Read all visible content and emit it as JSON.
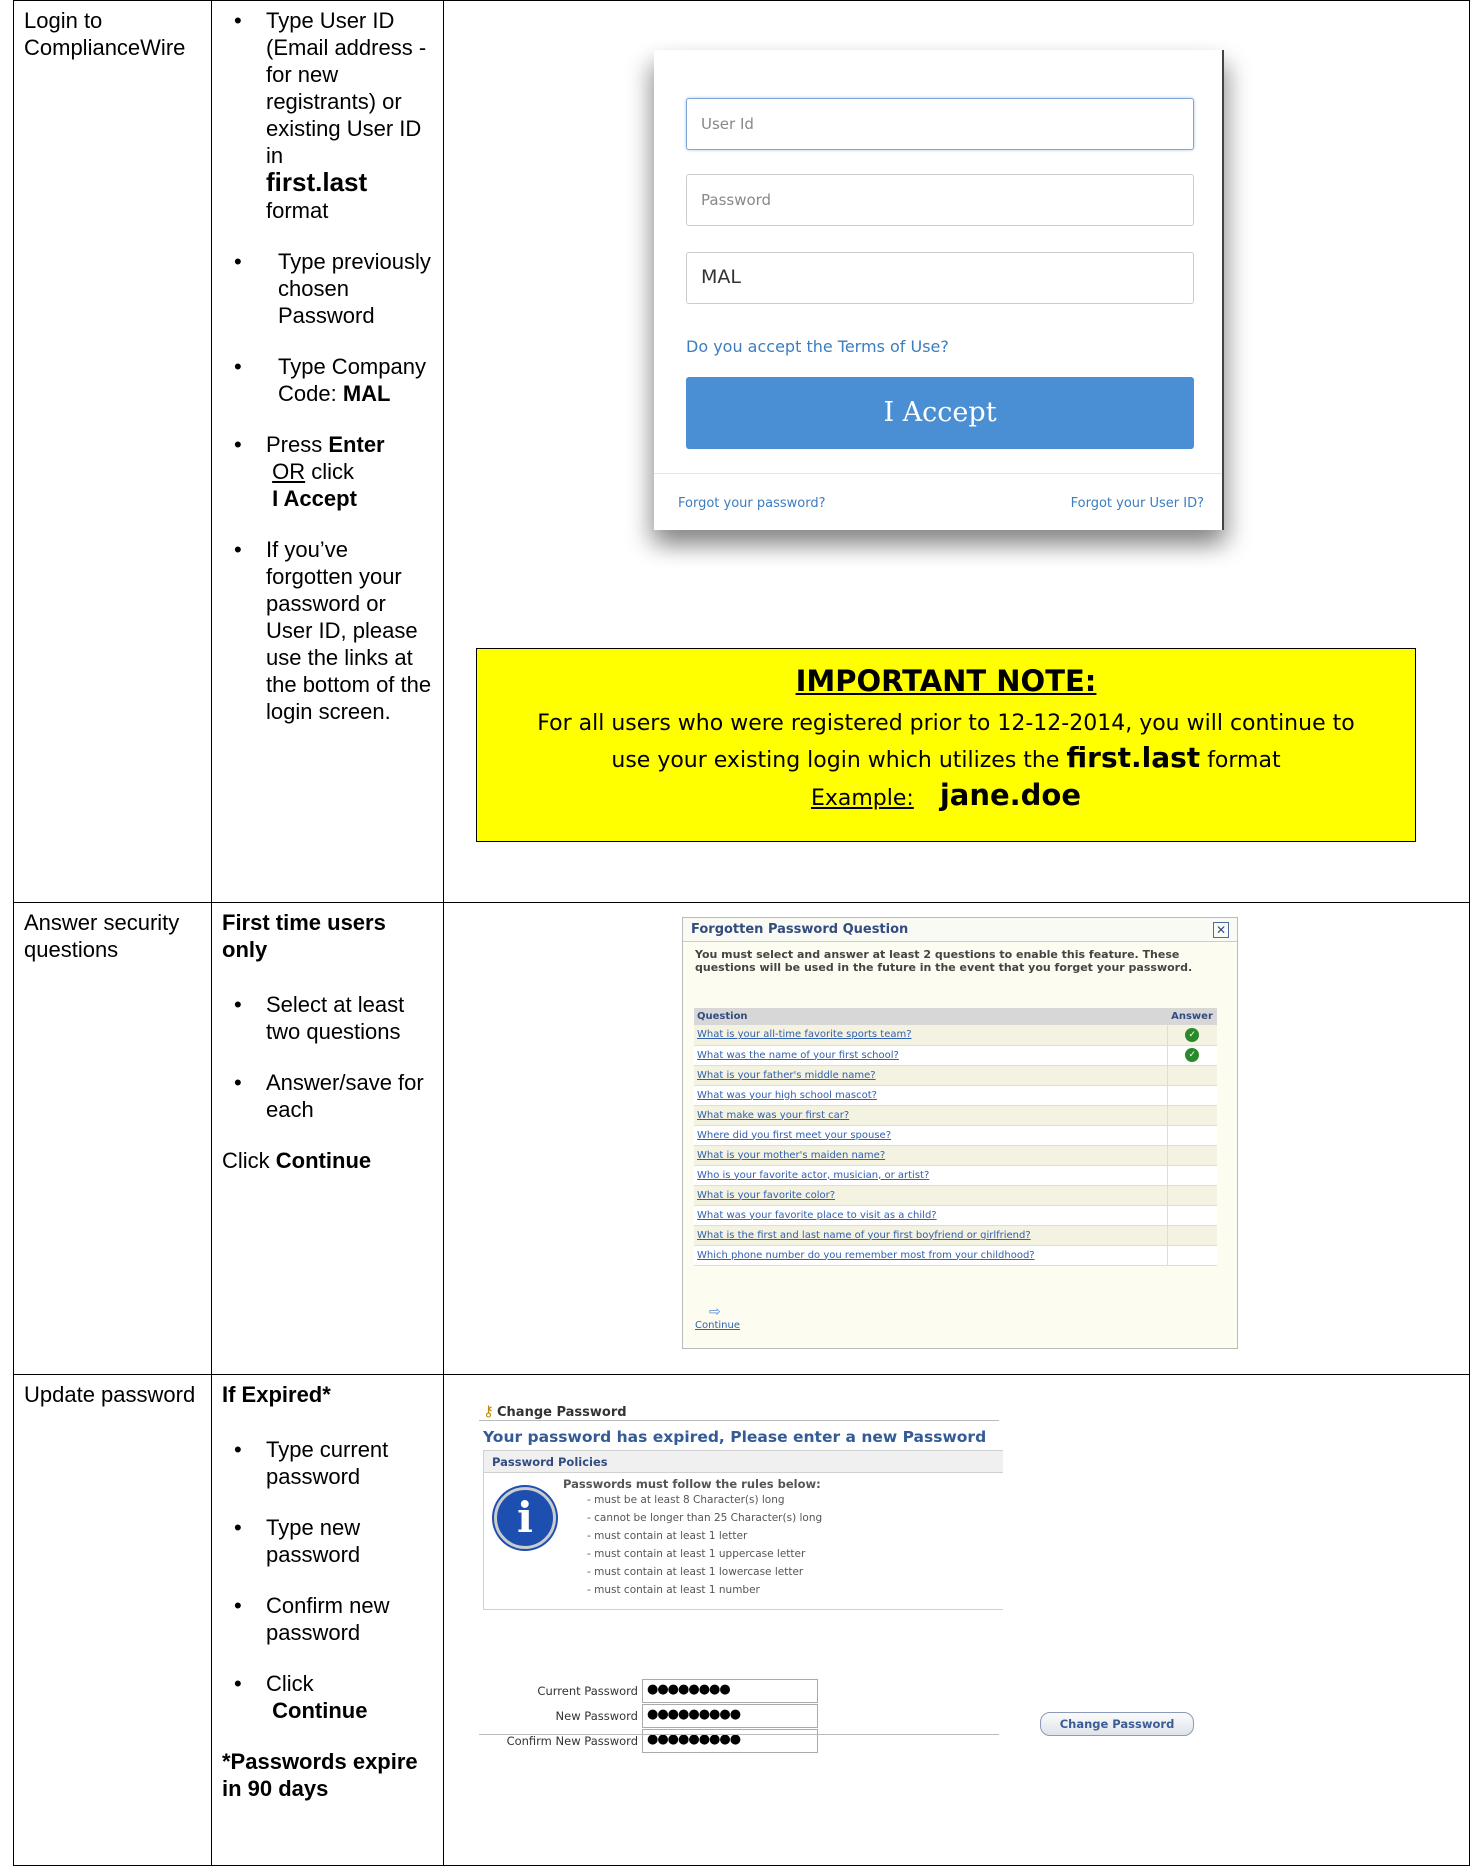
{
  "rows": [
    {
      "step": "Login to ComplianceWire",
      "instr": {
        "userid_pre": "Type User ID (Email address - for new registrants) or existing User ID in",
        "userid_fmt": "first.last",
        "userid_post": "format",
        "password": "Type previously chosen Password",
        "company_pre": "Type Company Code:",
        "company_code": "MAL",
        "press": "Press",
        "enter": "Enter",
        "or": "OR",
        "click": "click",
        "accept": "I Accept",
        "forgot": "If you’ve forgotten your password or User ID, please use the links at the bottom of the login screen."
      }
    },
    {
      "step": "Answer security questions",
      "instr": {
        "first_time": "First time users only",
        "select": "Select at least two questions",
        "answer": "Answer/save for each",
        "click": "Click",
        "continue": "Continue"
      }
    },
    {
      "step": "Update password",
      "instr": {
        "if_expired": "If Expired*",
        "current": "Type current password",
        "new": "Type new password",
        "confirm": "Confirm new password",
        "click": "Click",
        "continue": "Continue",
        "footnote": "*Passwords expire in 90 days"
      }
    }
  ],
  "login": {
    "userid_placeholder": "User Id",
    "password_placeholder": "Password",
    "company_value": "MAL",
    "terms_link": "Do you accept the Terms of Use?",
    "accept_button": "I Accept",
    "forgot_password": "Forgot your password?",
    "forgot_userid": "Forgot your User ID?"
  },
  "note": {
    "heading": "IMPORTANT NOTE:",
    "line1": "For all users who were registered prior to 12-12-2014, you will continue to",
    "line2_pre": "use your existing login which utilizes the",
    "line2_fmt": "first.last",
    "line2_post": "format",
    "example_label": "Example:",
    "example_value": "jane.doe"
  },
  "fpq": {
    "title": "Forgotten Password Question",
    "close": "✕",
    "intro": "You must select and answer at least 2 questions to enable this feature. These questions will be used in the future in the event that you forget your password.",
    "col_question": "Question",
    "col_answer": "Answer",
    "questions": [
      {
        "q": "What is your all-time favorite sports team?",
        "answered": true
      },
      {
        "q": "What was the name of your first school?",
        "answered": true
      },
      {
        "q": "What is your father's middle name?",
        "answered": false
      },
      {
        "q": "What was your high school mascot?",
        "answered": false
      },
      {
        "q": "What make was your first car?",
        "answered": false
      },
      {
        "q": "Where did you first meet your spouse?",
        "answered": false
      },
      {
        "q": "What is your mother's maiden name?",
        "answered": false
      },
      {
        "q": "Who is your favorite actor, musician, or artist?",
        "answered": false
      },
      {
        "q": "What is your favorite color?",
        "answered": false
      },
      {
        "q": "What was your favorite place to visit as a child?",
        "answered": false
      },
      {
        "q": "What is the first and last name of your first boyfriend or girlfriend?",
        "answered": false
      },
      {
        "q": "Which phone number do you remember most from your childhood?",
        "answered": false
      }
    ],
    "continue": "Continue"
  },
  "change_password": {
    "title": "Change Password",
    "expired_msg": "Your password has expired, Please enter a new Password",
    "policies_title": "Password Policies",
    "rules_header": "Passwords must follow the rules below:",
    "rules": [
      "- must be at least 8 Character(s) long",
      "- cannot be longer than 25 Character(s) long",
      "- must contain at least 1 letter",
      "- must contain at least 1 uppercase letter",
      "- must contain at least 1 lowercase letter",
      "- must contain at least 1 number"
    ],
    "current_label": "Current Password",
    "current_value": "●●●●●●●●",
    "new_label": "New Password",
    "new_value": "●●●●●●●●●",
    "confirm_label": "Confirm New Password",
    "confirm_value": "●●●●●●●●●",
    "button": "Change Password"
  }
}
